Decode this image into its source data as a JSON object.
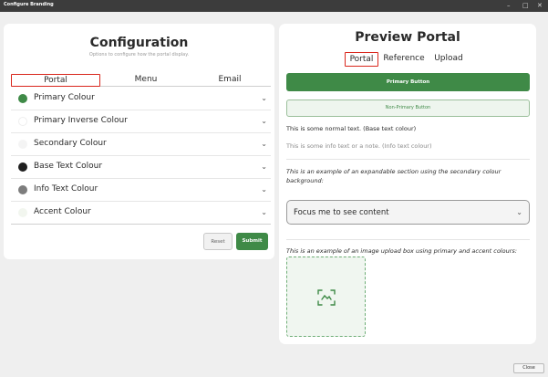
{
  "window": {
    "title": "Configure Branding",
    "minimize_glyph": "–",
    "maximize_glyph": "□",
    "close_glyph": "✕"
  },
  "configuration": {
    "title": "Configuration",
    "subtitle": "Options to configure how the portal display.",
    "tabs": [
      "Portal",
      "Menu",
      "Email"
    ],
    "active_tab": "Portal",
    "colours": [
      {
        "label": "Primary Colour",
        "color": "#3f8a47"
      },
      {
        "label": "Primary Inverse Colour",
        "color": "#ffffff"
      },
      {
        "label": "Secondary Colour",
        "color": "#f4f4f4"
      },
      {
        "label": "Base Text Colour",
        "color": "#1f1f1f"
      },
      {
        "label": "Info Text Colour",
        "color": "#7d7d7d"
      },
      {
        "label": "Accent Colour",
        "color": "#f2f6ef"
      }
    ],
    "reset_label": "Reset",
    "submit_label": "Submit"
  },
  "preview": {
    "title": "Preview Portal",
    "tabs": [
      "Portal",
      "Reference",
      "Upload"
    ],
    "active_tab": "Portal",
    "primary_button": "Primary Button",
    "non_primary_button": "Non-Primary Button",
    "normal_text": "This is some normal text. (Base text colour)",
    "info_text": "This is some info text or a note. (Info text colour)",
    "expandable_note": "This is an example of an expandable section using the secondary colour background:",
    "focus_text": "Focus me to see content",
    "upload_note": "This is an example of an image upload box using primary and accent colours:"
  },
  "footer": {
    "close_label": "Close"
  },
  "icons": {
    "chevron": "chevron-down-icon",
    "upload": "image-upload-icon"
  }
}
